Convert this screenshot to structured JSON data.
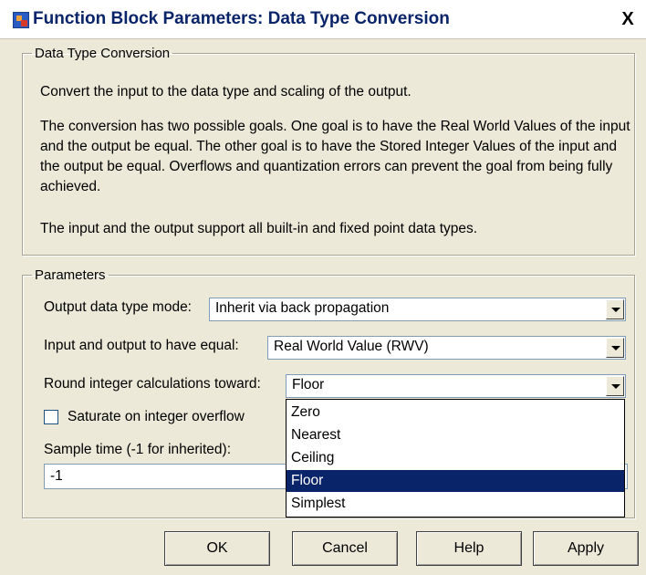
{
  "window": {
    "title": "Function Block Parameters: Data Type Conversion",
    "close_label": "X"
  },
  "description": {
    "legend": "Data Type Conversion",
    "para1": "Convert the input to the data type and scaling of the output.",
    "para2": "The conversion has two possible goals. One goal is to have the Real World Values of the input and the output be equal.  The other goal is to have the Stored Integer Values of the input and the output be equal.  Overflows and quantization errors can prevent the goal from being fully achieved.",
    "para3": "The input and the output support all built-in and fixed point data types."
  },
  "parameters": {
    "legend": "Parameters",
    "output_mode_label": "Output data type mode:",
    "output_mode_value": "Inherit via back propagation",
    "equal_label": "Input and output to have equal:",
    "equal_value": "Real World Value (RWV)",
    "round_label": "Round integer calculations toward:",
    "round_value": "Floor",
    "round_options": [
      "Zero",
      "Nearest",
      "Ceiling",
      "Floor",
      "Simplest"
    ],
    "round_selected_index": 3,
    "saturate_label": "Saturate on integer overflow",
    "saturate_checked": false,
    "sample_label": "Sample time (-1 for inherited):",
    "sample_value": "-1"
  },
  "buttons": {
    "ok": "OK",
    "cancel": "Cancel",
    "help": "Help",
    "apply": "Apply"
  },
  "colors": {
    "dialog_bg": "#ece9d8",
    "title_text": "#0a246a",
    "selection_bg": "#0a246a"
  }
}
